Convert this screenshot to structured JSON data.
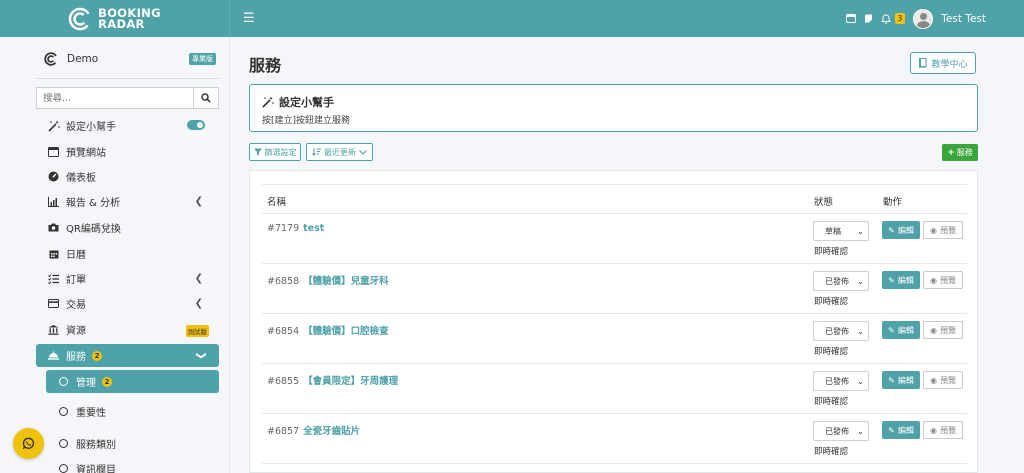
{
  "header": {
    "brand_line1": "BOOKING",
    "brand_line2": "RADAR",
    "notification_count": "3",
    "username": "Test Test"
  },
  "sidebar": {
    "account_name": "Demo",
    "plan_badge": "專業版",
    "search_placeholder": "搜尋...",
    "items": [
      {
        "label": "設定小幫手",
        "icon": "magic-wand-icon"
      },
      {
        "label": "預覽網站",
        "icon": "browser-icon"
      },
      {
        "label": "儀表板",
        "icon": "dashboard-icon"
      },
      {
        "label": "報告 & 分析",
        "icon": "bar-chart-icon"
      },
      {
        "label": "QR編碼兌換",
        "icon": "camera-icon"
      },
      {
        "label": "日曆",
        "icon": "calendar-icon"
      },
      {
        "label": "訂單",
        "icon": "list-check-icon"
      },
      {
        "label": "交易",
        "icon": "credit-card-icon"
      },
      {
        "label": "資源",
        "icon": "bank-icon",
        "badge": "測試版"
      },
      {
        "label": "服務",
        "icon": "bell-service-icon",
        "badge": "2"
      }
    ],
    "sub_items": [
      {
        "label": "管理",
        "badge": "2"
      },
      {
        "label": "重要性"
      },
      {
        "label": "服務類別"
      },
      {
        "label": "資訊欄目"
      }
    ]
  },
  "main": {
    "title": "服務",
    "tutorial_label": "教學中心",
    "helper_title": "設定小幫手",
    "helper_text": "按[建立]按鈕建立服務",
    "filter_label": "篩選設定",
    "sort_label": "最近更新",
    "add_label": "服務",
    "columns": {
      "name": "名稱",
      "status": "狀態",
      "actions": "動作"
    },
    "edit_label": "編輯",
    "preview_label": "預覽",
    "confirm_label": "即時確認",
    "rows": [
      {
        "id": "#7179",
        "name": "test",
        "status": "草稿"
      },
      {
        "id": "#6858",
        "name": "【體驗價】兒童牙科",
        "status": "已發佈"
      },
      {
        "id": "#6854",
        "name": "【體驗價】口腔檢查",
        "status": "已發佈"
      },
      {
        "id": "#6855",
        "name": "【會員限定】牙周護理",
        "status": "已發佈"
      },
      {
        "id": "#6857",
        "name": "全瓷牙齒貼片",
        "status": "已發佈"
      }
    ]
  },
  "colors": {
    "brand": "#4fa2a8",
    "badge": "#f0c20c",
    "success": "#3aa53a"
  }
}
